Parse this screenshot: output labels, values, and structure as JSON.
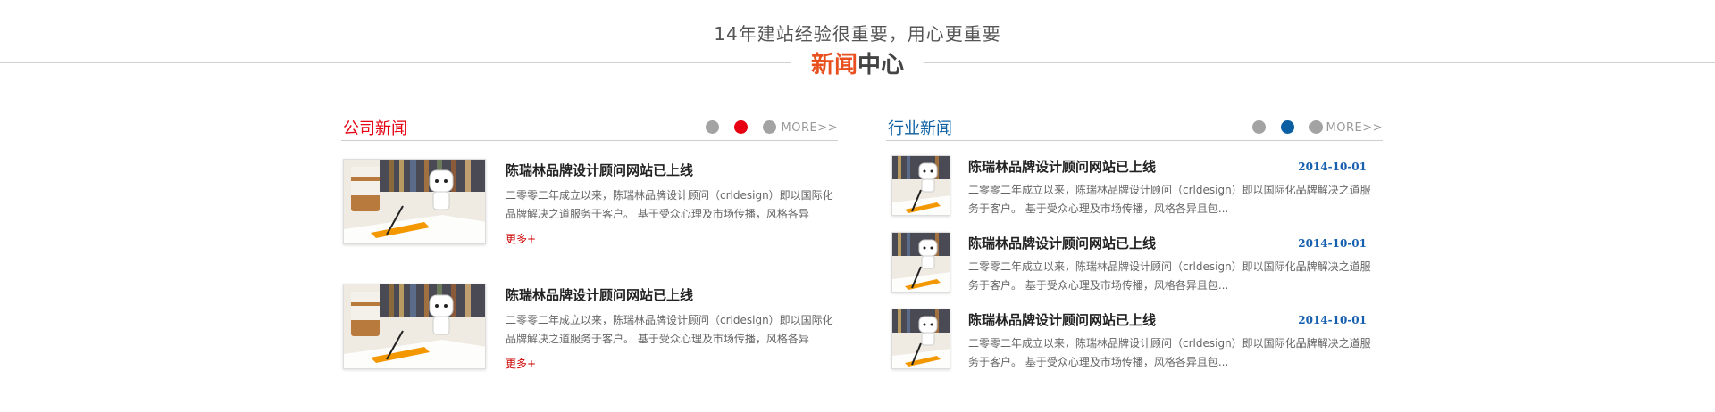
{
  "header": {
    "slogan": "14年建站经验很重要，用心更重要",
    "title_highlight": "新闻",
    "title_rest": "中心"
  },
  "company_news": {
    "title": "公司新闻",
    "more": "MORE>>",
    "active_dot": 2,
    "items": [
      {
        "title": "陈瑞林品牌设计顾问网站已上线",
        "desc": "二零零二年成立以来，陈瑞林品牌设计顾问（crldesign）即以国际化品牌解决之道服务于客户。 基于受众心理及市场传播，风格各异",
        "more": "更多+"
      },
      {
        "title": "陈瑞林品牌设计顾问网站已上线",
        "desc": "二零零二年成立以来，陈瑞林品牌设计顾问（crldesign）即以国际化品牌解决之道服务于客户。 基于受众心理及市场传播，风格各异",
        "more": "更多+"
      }
    ]
  },
  "industry_news": {
    "title": "行业新闻",
    "more": "MORE>>",
    "active_dot": 2,
    "items": [
      {
        "title": "陈瑞林品牌设计顾问网站已上线",
        "date": "2014-10-01",
        "desc": "二零零二年成立以来，陈瑞林品牌设计顾问（crldesign）即以国际化品牌解决之道服务于客户。 基于受众心理及市场传播，风格各异且包..."
      },
      {
        "title": "陈瑞林品牌设计顾问网站已上线",
        "date": "2014-10-01",
        "desc": "二零零二年成立以来，陈瑞林品牌设计顾问（crldesign）即以国际化品牌解决之道服务于客户。 基于受众心理及市场传播，风格各异且包..."
      },
      {
        "title": "陈瑞林品牌设计顾问网站已上线",
        "date": "2014-10-01",
        "desc": "二零零二年成立以来，陈瑞林品牌设计顾问（crldesign）即以国际化品牌解决之道服务于客户。 基于受众心理及市场传播，风格各异且包..."
      }
    ]
  },
  "colors": {
    "accent_orange": "#e8501f",
    "company_red": "#e60012",
    "industry_blue": "#0a5fa3",
    "date_blue": "#1760b0",
    "dot_gray": "#a3a3a3"
  }
}
